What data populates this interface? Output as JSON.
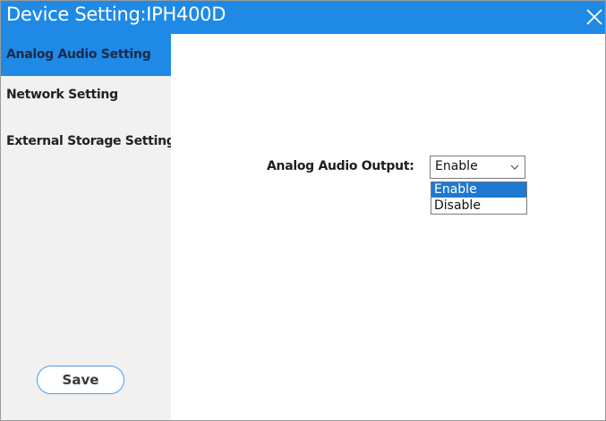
{
  "window": {
    "title": "Device Setting:IPH400D",
    "close_icon": "close-icon"
  },
  "sidebar": {
    "items": [
      {
        "label": "Analog Audio Setting",
        "active": true
      },
      {
        "label": "Network Setting",
        "active": false
      },
      {
        "label": "External Storage Setting",
        "active": false
      }
    ],
    "save_label": "Save"
  },
  "content": {
    "analog_audio_output": {
      "label": "Analog Audio Output:",
      "selected": "Enable",
      "chevron_icon": "chevron-down-icon",
      "options": [
        "Enable",
        "Disable"
      ],
      "highlighted_option": "Enable"
    }
  },
  "colors": {
    "accent": "#1f8ae6",
    "sidebar_bg": "#f1f1f1",
    "option_highlight": "#1f78d1"
  }
}
